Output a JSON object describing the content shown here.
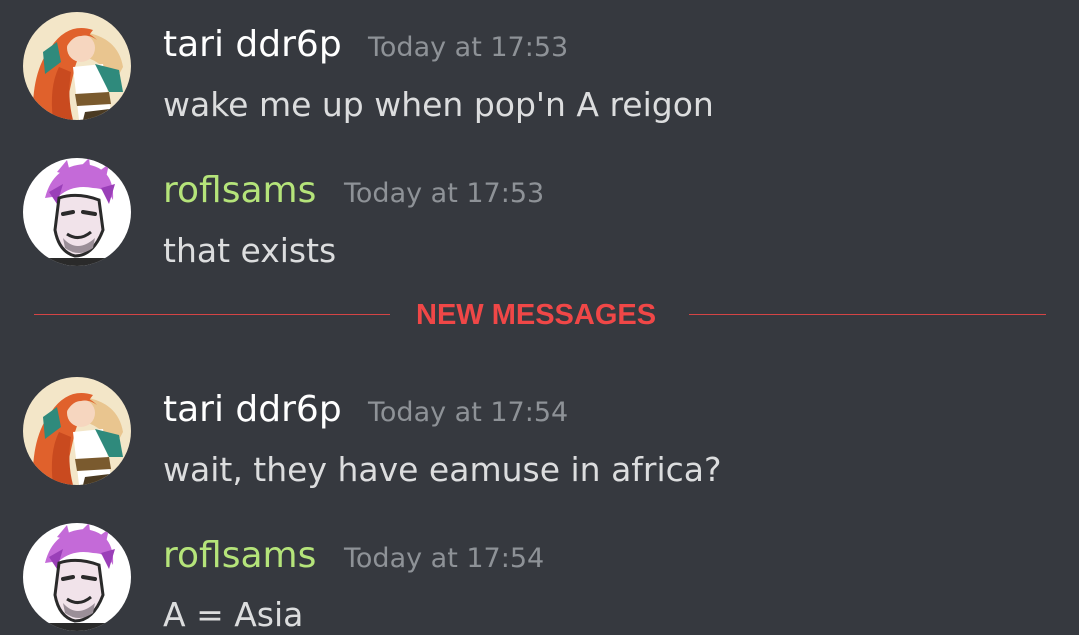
{
  "colors": {
    "background": "#36393f",
    "username_default": "#ffffff",
    "username_green": "#b5e47a",
    "timestamp": "#8e9297",
    "message_text": "#dcddde",
    "new_messages": "#f04747"
  },
  "divider": {
    "label": "NEW MESSAGES"
  },
  "messages": [
    {
      "author": "tari ddr6p",
      "avatar_icon": "anime-girl-orange-hair-avatar",
      "timestamp": "Today at 17:53",
      "text": "wake me up when pop'n A reigon"
    },
    {
      "author": "roflsams",
      "avatar_icon": "purple-haired-character-avatar",
      "timestamp": "Today at 17:53",
      "text": "that exists"
    },
    {
      "author": "tari ddr6p",
      "avatar_icon": "anime-girl-orange-hair-avatar",
      "timestamp": "Today at 17:54",
      "text": "wait, they have eamuse in africa?"
    },
    {
      "author": "roflsams",
      "avatar_icon": "purple-haired-character-avatar",
      "timestamp": "Today at 17:54",
      "text": "A = Asia"
    }
  ]
}
